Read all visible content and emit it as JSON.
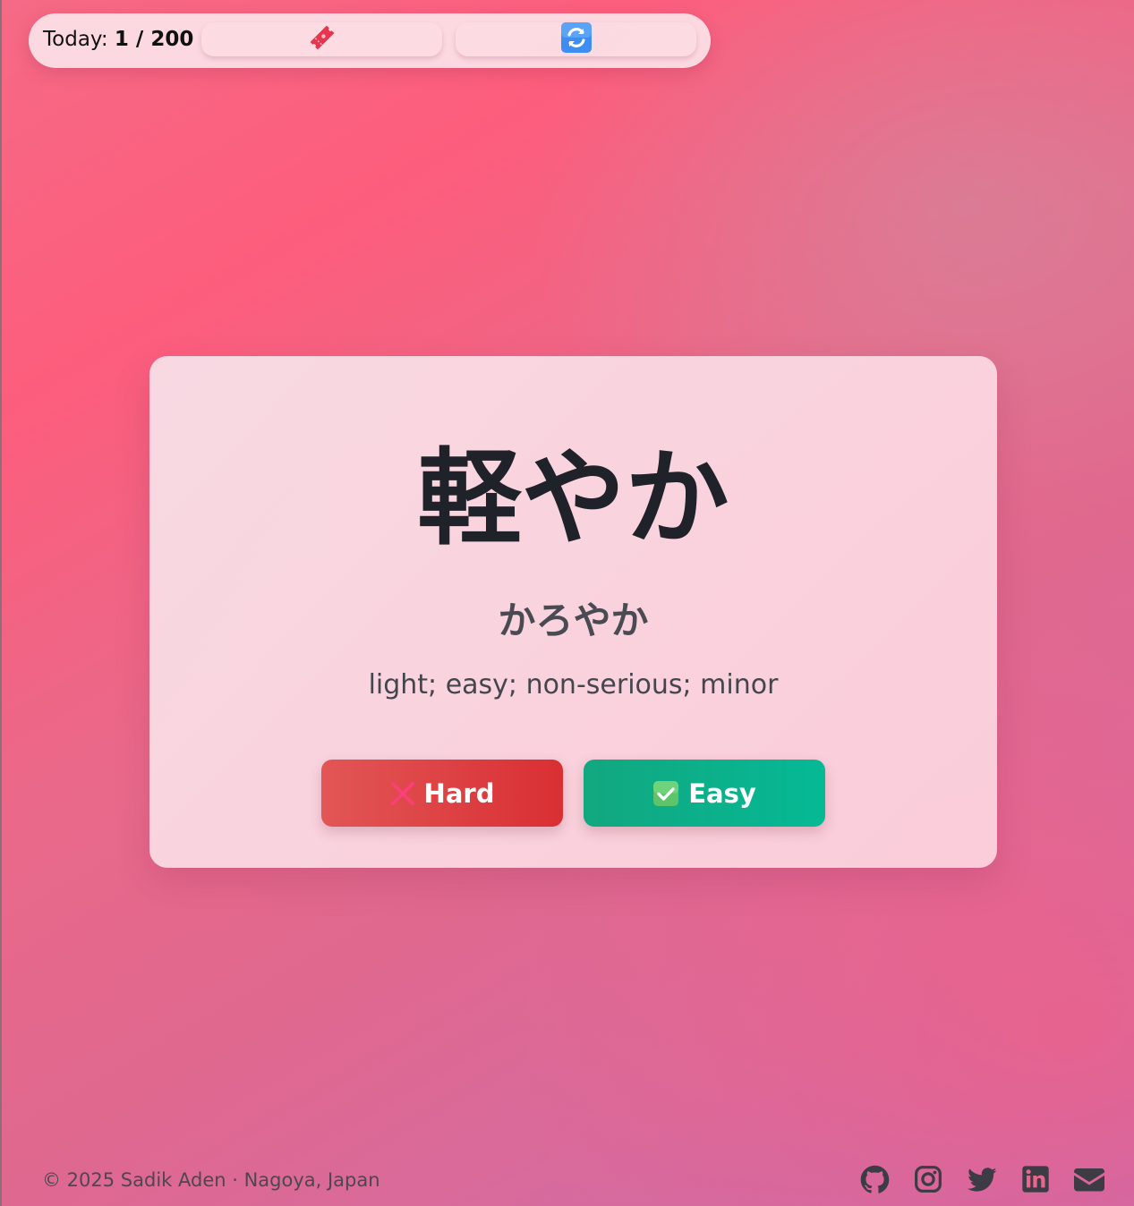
{
  "header": {
    "today_label": "Today:",
    "today_count": "1 / 200",
    "buttons": [
      {
        "icon": "ticket-icon"
      },
      {
        "icon": "refresh-icon"
      }
    ]
  },
  "card": {
    "word": "軽やか",
    "reading": "かろやか",
    "meaning": "light; easy; non-serious; minor",
    "hard_label": "Hard",
    "easy_label": "Easy"
  },
  "footer": {
    "copyright": "© 2025 Sadik Aden · Nagoya, Japan",
    "social": [
      "github-icon",
      "instagram-icon",
      "twitter-icon",
      "linkedin-icon",
      "mail-icon"
    ]
  },
  "colors": {
    "hard": "#d92f33",
    "easy": "#05b995",
    "text_dark": "#1f2228"
  }
}
